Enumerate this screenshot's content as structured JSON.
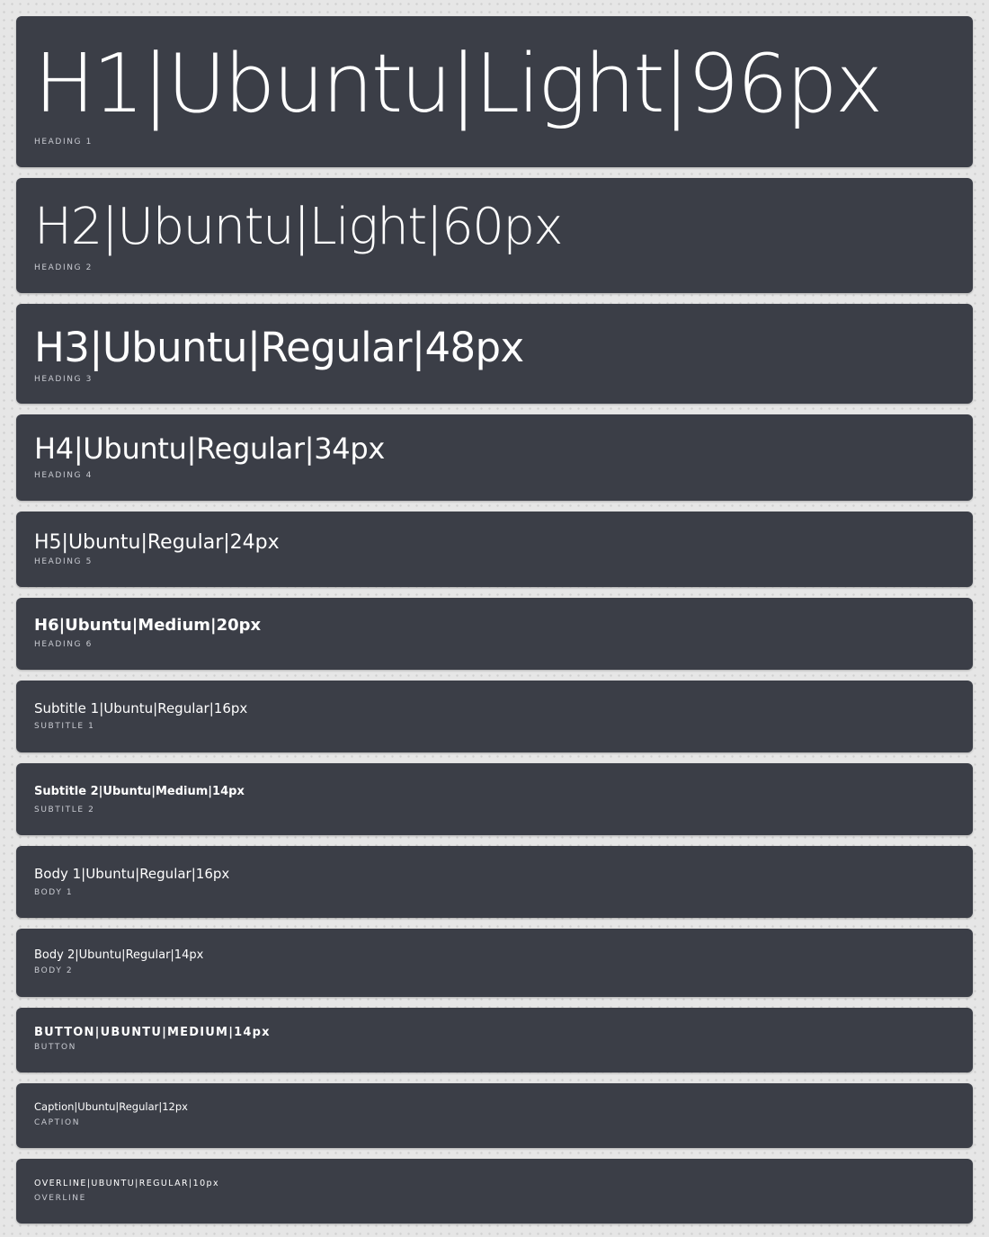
{
  "colors": {
    "page_background": "#e6e6e6",
    "card_background": "#3b3e47",
    "sample_text": "#ffffff",
    "tag_text": "#c9cbd2"
  },
  "rows": [
    {
      "sample": "H1|Ubuntu|Light|96px",
      "tag": "HEADING 1"
    },
    {
      "sample": "H2|Ubuntu|Light|60px",
      "tag": "HEADING 2"
    },
    {
      "sample": "H3|Ubuntu|Regular|48px",
      "tag": "HEADING 3"
    },
    {
      "sample": "H4|Ubuntu|Regular|34px",
      "tag": "HEADING 4"
    },
    {
      "sample": "H5|Ubuntu|Regular|24px",
      "tag": "HEADING 5"
    },
    {
      "sample": "H6|Ubuntu|Medium|20px",
      "tag": "HEADING 6"
    },
    {
      "sample": "Subtitle 1|Ubuntu|Regular|16px",
      "tag": "SUBTITLE 1"
    },
    {
      "sample": "Subtitle 2|Ubuntu|Medium|14px",
      "tag": "SUBTITLE 2"
    },
    {
      "sample": "Body 1|Ubuntu|Regular|16px",
      "tag": "BODY 1"
    },
    {
      "sample": "Body 2|Ubuntu|Regular|14px",
      "tag": "BODY 2"
    },
    {
      "sample": "BUTTON|UBUNTU|MEDIUM|14px",
      "tag": "BUTTON"
    },
    {
      "sample": "Caption|Ubuntu|Regular|12px",
      "tag": "CAPTION"
    },
    {
      "sample": "OVERLINE|UBUNTU|REGULAR|10px",
      "tag": "OVERLINE"
    }
  ]
}
